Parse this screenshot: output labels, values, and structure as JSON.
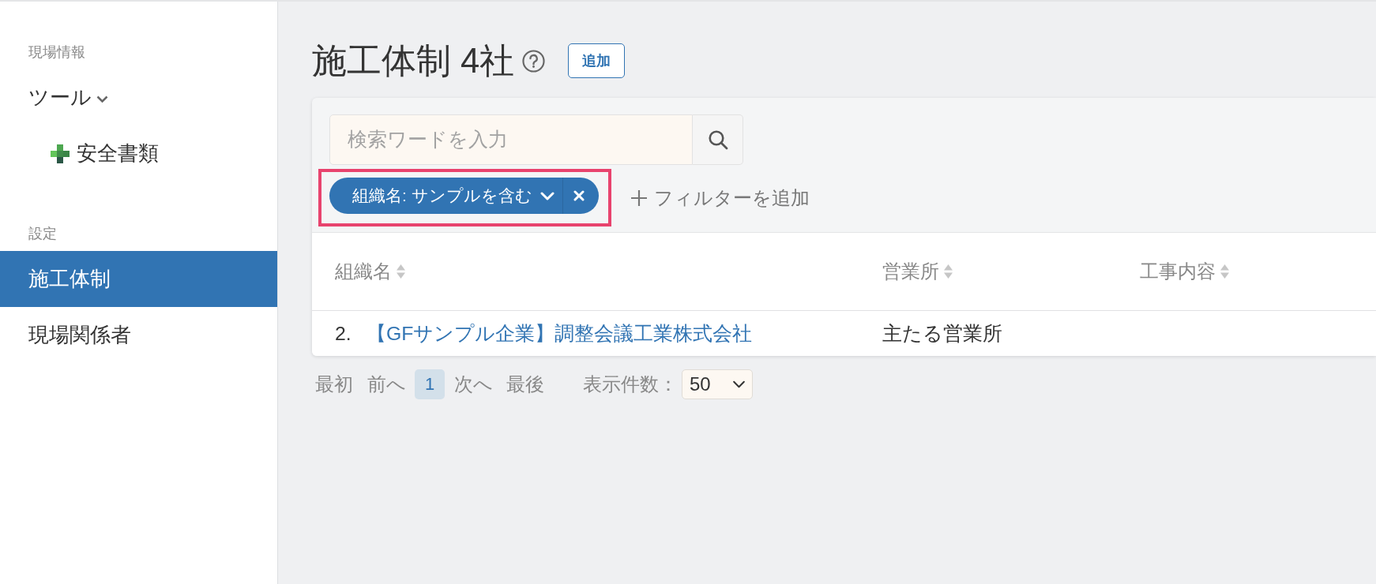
{
  "sidebar": {
    "sections": [
      {
        "heading": "現場情報",
        "items": [
          {
            "label": "ツール",
            "kind": "menu",
            "selected": false,
            "expanded": true,
            "children": [
              {
                "label": "安全書類",
                "kind": "tool",
                "selected": false
              }
            ]
          }
        ]
      },
      {
        "heading": "設定",
        "items": [
          {
            "label": "施工体制",
            "kind": "link",
            "selected": true
          },
          {
            "label": "現場関係者",
            "kind": "link",
            "selected": false
          }
        ]
      }
    ]
  },
  "header": {
    "title": "施工体制 4社",
    "add_button": "追加"
  },
  "search": {
    "placeholder": "検索ワードを入力"
  },
  "filters": [
    {
      "label": "組織名: サンプルを含む",
      "highlighted": true
    }
  ],
  "add_filter": "フィルターを追加",
  "table": {
    "columns": [
      {
        "label": "組織名"
      },
      {
        "label": "営業所"
      },
      {
        "label": "工事内容"
      }
    ],
    "rows": [
      {
        "number": "2.",
        "cells": [
          {
            "kind": "link",
            "text": "【GFサンプル企業】調整会議工業株式会社"
          },
          {
            "kind": "text",
            "text": "主たる営業所"
          }
        ]
      }
    ]
  },
  "pagination": {
    "first": "最初",
    "previous": "前へ",
    "pages": [
      {
        "label": "1",
        "selected": true
      }
    ],
    "next": "次へ",
    "last": "最後",
    "page_size_label": "表示件数：",
    "page_size": "50"
  }
}
